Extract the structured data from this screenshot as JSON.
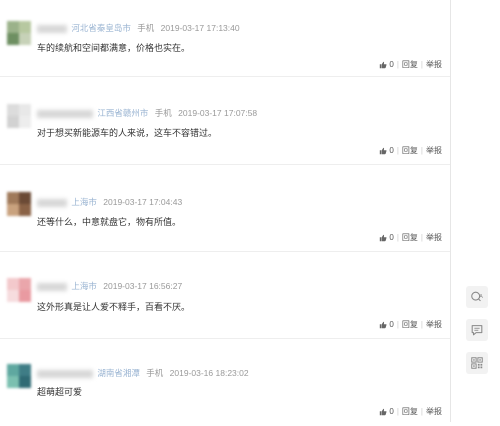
{
  "comments": [
    {
      "location": "河北省秦皇岛市",
      "device": "手机",
      "time": "2019-03-17 17:13:40",
      "text": "车的续航和空间都满意，价格也实在。",
      "likes": "0",
      "reply_label": "回复",
      "report_label": "举报",
      "avatar_colors": [
        "#9bb28a",
        "#b7c8a0",
        "#6e8f62",
        "#c7d2b8"
      ]
    },
    {
      "location": "江西省赣州市",
      "device": "手机",
      "time": "2019-03-17 17:07:58",
      "text": "对于想买新能源车的人来说，这车不容错过。",
      "likes": "0",
      "reply_label": "回复",
      "report_label": "举报",
      "avatar_colors": [
        "#dcdcdc",
        "#e8e8e8",
        "#d2d2d2",
        "#ededed"
      ]
    },
    {
      "location": "上海市",
      "device": "",
      "time": "2019-03-17 17:04:43",
      "text": "还等什么，中意就盘它，物有所值。",
      "likes": "0",
      "reply_label": "回复",
      "report_label": "举报",
      "avatar_colors": [
        "#a07a5a",
        "#6b4a35",
        "#c9a27e",
        "#8a6246"
      ]
    },
    {
      "location": "上海市",
      "device": "",
      "time": "2019-03-17 16:56:27",
      "text": "这外形真是让人爱不释手，百看不厌。",
      "likes": "0",
      "reply_label": "回复",
      "report_label": "举报",
      "avatar_colors": [
        "#f3c9cc",
        "#eaa6ab",
        "#f6dcde",
        "#e99aa1"
      ]
    },
    {
      "location": "湖南省湘潭",
      "device": "手机",
      "time": "2019-03-16 18:23:02",
      "text": "超萌超可爱",
      "likes": "0",
      "reply_label": "回复",
      "report_label": "举报",
      "avatar_colors": [
        "#5fa8a0",
        "#3f7d86",
        "#7bc0b0",
        "#2f6a74"
      ]
    }
  ],
  "sidebar": {
    "buttons": [
      {
        "icon": "qa-icon"
      },
      {
        "icon": "comment-icon"
      },
      {
        "icon": "qrcode-icon"
      }
    ]
  }
}
